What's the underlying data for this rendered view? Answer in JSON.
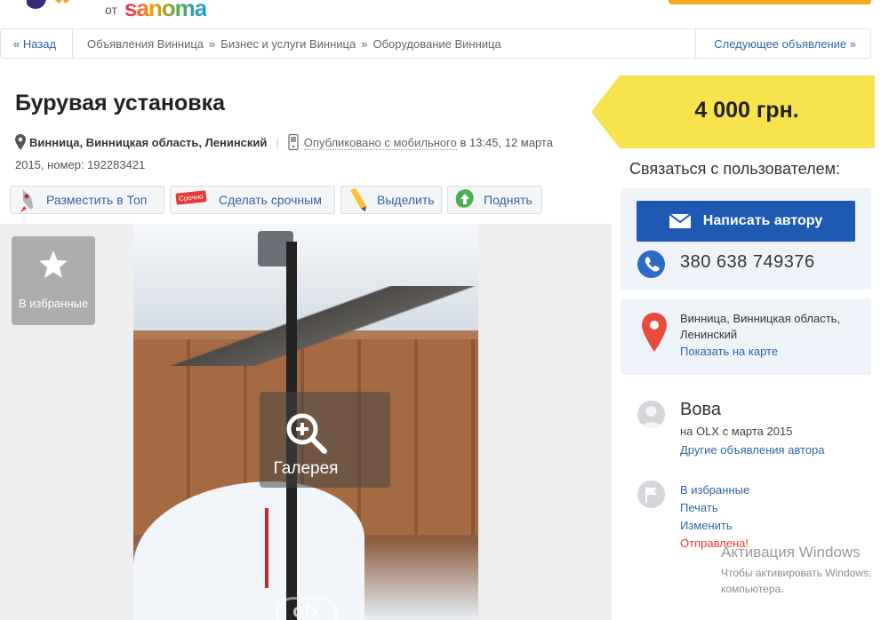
{
  "header": {
    "logo_ot": "от",
    "logo_brand": "sanoma"
  },
  "breadcrumb": {
    "back": "« Назад",
    "items": [
      "Объявления Винница",
      "Бизнес и услуги Винница",
      "Оборудование Винница"
    ],
    "separator": "»",
    "next": "Следующее объявление »"
  },
  "listing": {
    "title": "Бурувая установка",
    "location": "Винница, Винницкая область, Ленинский",
    "published_mobile": "Опубликовано с мобильного",
    "published_rest": " в 13:45, 12 марта 2015, номер: 192283421"
  },
  "promo": {
    "top": "Разместить в Топ",
    "urgent": "Сделать срочным",
    "urgent_badge": "Срочно",
    "highlight": "Выделить",
    "raise": "Поднять"
  },
  "gallery": {
    "favorite": "В избранные",
    "gallery": "Галерея",
    "watermark": "olx"
  },
  "sidebar": {
    "price": "4 000 грн.",
    "contact_heading": "Связаться с пользователем:",
    "write_button": "Написать автору",
    "phone": "380 638 749376",
    "location": "Винница, Винницкая область, Ленинский",
    "map_link": "Показать на карте",
    "user_name": "Вова",
    "user_since": "на OLX с марта 2015",
    "other_ads": "Другие объявления автора",
    "actions": {
      "favorite": "В избранные",
      "print": "Печать",
      "edit": "Изменить",
      "sent": "Отправлена!"
    }
  },
  "windows_activation": {
    "title": "Активация Windows",
    "body": "Чтобы активировать Windows, компьютера."
  },
  "colors": {
    "link": "#3465a4",
    "price_tag": "#f6e34d",
    "primary_button": "#1f5ab2",
    "panel": "#eef3f9",
    "brand_orange": "#f7a81b"
  }
}
